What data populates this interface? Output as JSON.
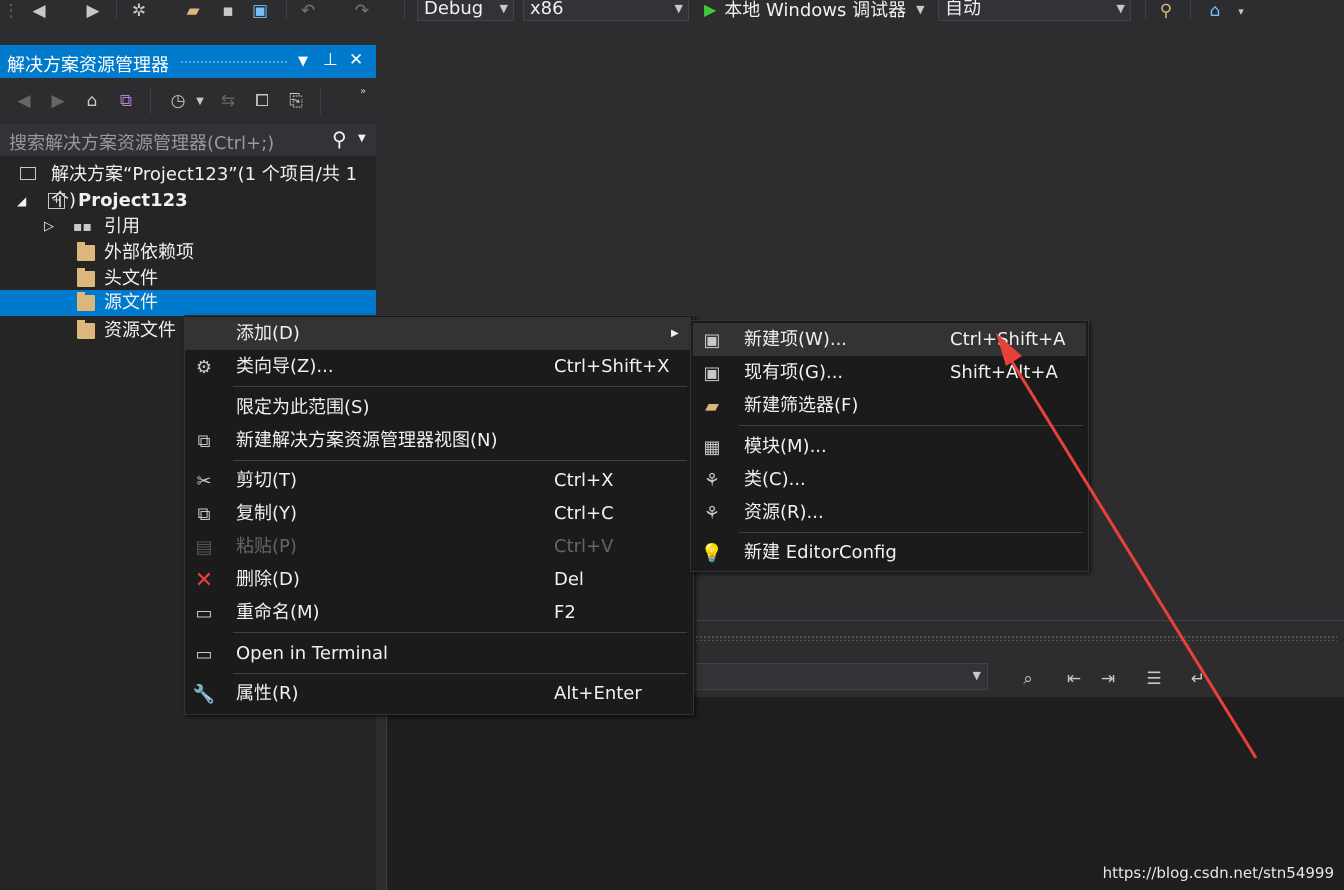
{
  "toolbar": {
    "config": "Debug",
    "platform": "x86",
    "debugger_label": "本地 Windows 调试器",
    "mode": "自动"
  },
  "solution_explorer": {
    "title": "解决方案资源管理器",
    "search_placeholder": "搜索解决方案资源管理器(Ctrl+;)",
    "tree": [
      {
        "label": "解决方案“Project123”(1 个项目/共 1 个)",
        "icon": "solution-icon"
      },
      {
        "label": "Project123",
        "icon": "project-icon"
      },
      {
        "label": "引用",
        "icon": "references-icon"
      },
      {
        "label": "外部依赖项",
        "icon": "external-deps-icon"
      },
      {
        "label": "头文件",
        "icon": "folder-icon"
      },
      {
        "label": "源文件",
        "icon": "folder-icon"
      },
      {
        "label": "资源文件",
        "icon": "folder-icon"
      }
    ]
  },
  "context_menu": {
    "items": [
      {
        "label": "添加(D)",
        "shortcut": ""
      },
      {
        "label": "类向导(Z)...",
        "shortcut": "Ctrl+Shift+X"
      },
      {
        "label": "限定为此范围(S)",
        "shortcut": ""
      },
      {
        "label": "新建解决方案资源管理器视图(N)",
        "shortcut": ""
      },
      {
        "label": "剪切(T)",
        "shortcut": "Ctrl+X"
      },
      {
        "label": "复制(Y)",
        "shortcut": "Ctrl+C"
      },
      {
        "label": "粘贴(P)",
        "shortcut": "Ctrl+V"
      },
      {
        "label": "删除(D)",
        "shortcut": "Del"
      },
      {
        "label": "重命名(M)",
        "shortcut": "F2"
      },
      {
        "label": "Open in Terminal",
        "shortcut": ""
      },
      {
        "label": "属性(R)",
        "shortcut": "Alt+Enter"
      }
    ]
  },
  "submenu": {
    "items": [
      {
        "label": "新建项(W)...",
        "shortcut": "Ctrl+Shift+A"
      },
      {
        "label": "现有项(G)...",
        "shortcut": "Shift+Alt+A"
      },
      {
        "label": "新建筛选器(F)",
        "shortcut": ""
      },
      {
        "label": "模块(M)...",
        "shortcut": ""
      },
      {
        "label": "类(C)...",
        "shortcut": ""
      },
      {
        "label": "资源(R)...",
        "shortcut": ""
      },
      {
        "label": "新建 EditorConfig",
        "shortcut": ""
      }
    ]
  },
  "watermark": "https://blog.csdn.net/stn54999",
  "colors": {
    "accent": "#007acc",
    "annotation_arrow": "#e8413a"
  }
}
